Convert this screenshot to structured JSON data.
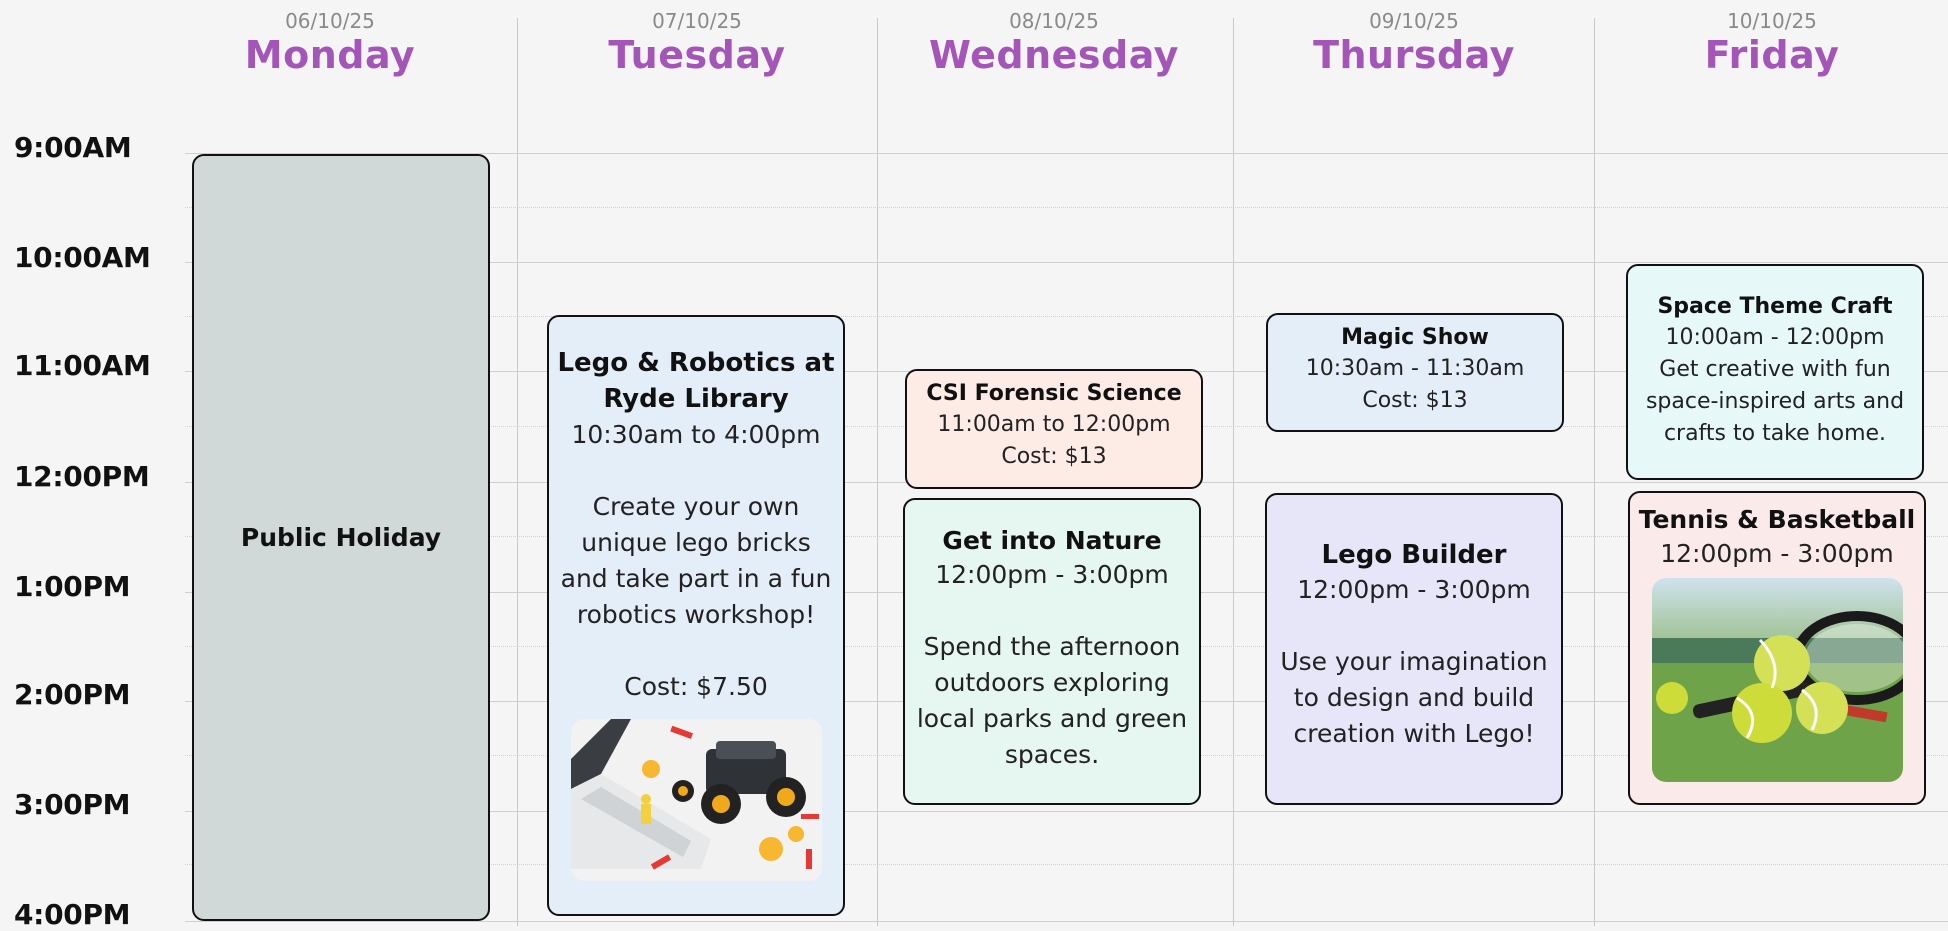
{
  "days": [
    {
      "date": "06/10/25",
      "name": "Monday"
    },
    {
      "date": "07/10/25",
      "name": "Tuesday"
    },
    {
      "date": "08/10/25",
      "name": "Wednesday"
    },
    {
      "date": "09/10/25",
      "name": "Thursday"
    },
    {
      "date": "10/10/25",
      "name": "Friday"
    }
  ],
  "times": [
    "9:00AM",
    "10:00AM",
    "11:00AM",
    "12:00PM",
    "1:00PM",
    "2:00PM",
    "3:00PM",
    "4:00PM"
  ],
  "events": {
    "monday_holiday": {
      "title": "Public Holiday",
      "color": "#d1d8d8"
    },
    "lego_robotics": {
      "title_line1": "Lego & Robotics at",
      "title_line2": "Ryde Library",
      "time": "10:30am to 4:00pm",
      "desc": [
        "Create your own",
        "unique lego bricks",
        "and take part in a fun",
        "robotics workshop!"
      ],
      "cost": "Cost: $7.50",
      "image": "lego-robot-and-laptop-photo",
      "color": "#e4eef8"
    },
    "csi": {
      "title": "CSI Forensic Science",
      "time": "11:00am to 12:00pm",
      "cost": "Cost: $13",
      "color": "#fdece6"
    },
    "nature": {
      "title": "Get into Nature",
      "time": "12:00pm - 3:00pm",
      "desc": [
        "Spend the afternoon",
        "outdoors exploring",
        "local parks and green",
        "spaces."
      ],
      "color": "#e6f6f0"
    },
    "magic": {
      "title": "Magic Show",
      "time": "10:30am - 11:30am",
      "cost": "Cost: $13",
      "color": "#e4eef8"
    },
    "lego_builder": {
      "title": "Lego Builder",
      "time": "12:00pm - 3:00pm",
      "desc": [
        "Use your imagination",
        "to design and build",
        "creation with Lego!"
      ],
      "color": "#e6e6f8"
    },
    "space": {
      "title": "Space Theme Craft",
      "time": "10:00am - 12:00pm",
      "desc": [
        "Get creative with fun",
        "space-inspired arts and",
        "crafts to take home."
      ],
      "color": "#e6f8f8"
    },
    "tennis": {
      "title": "Tennis & Basketball",
      "time": "12:00pm - 3:00pm",
      "image": "tennis-balls-and-racket-photo",
      "color": "#fbeaea"
    }
  },
  "colors": {
    "day_name": "#a456b8",
    "date": "#8a8a8a",
    "grid": "#cfcfcf"
  }
}
